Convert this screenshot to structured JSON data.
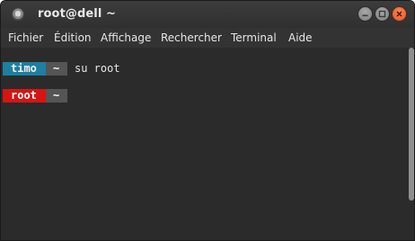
{
  "window": {
    "title": "root@dell ~"
  },
  "menu": {
    "items": [
      "Fichier",
      "Édition",
      "Affichage",
      "Rechercher",
      "Terminal",
      "Aide"
    ]
  },
  "terminal": {
    "lines": [
      {
        "user": "timo",
        "dir": "~",
        "command": "su root",
        "user_color": "#1e7fa0"
      },
      {
        "user": "root",
        "dir": "~",
        "command": "",
        "user_color": "#d61414"
      }
    ]
  },
  "icons": {
    "app": "terminal-app-icon",
    "minimize": "minimize-icon",
    "maximize": "maximize-icon",
    "close": "close-icon"
  }
}
